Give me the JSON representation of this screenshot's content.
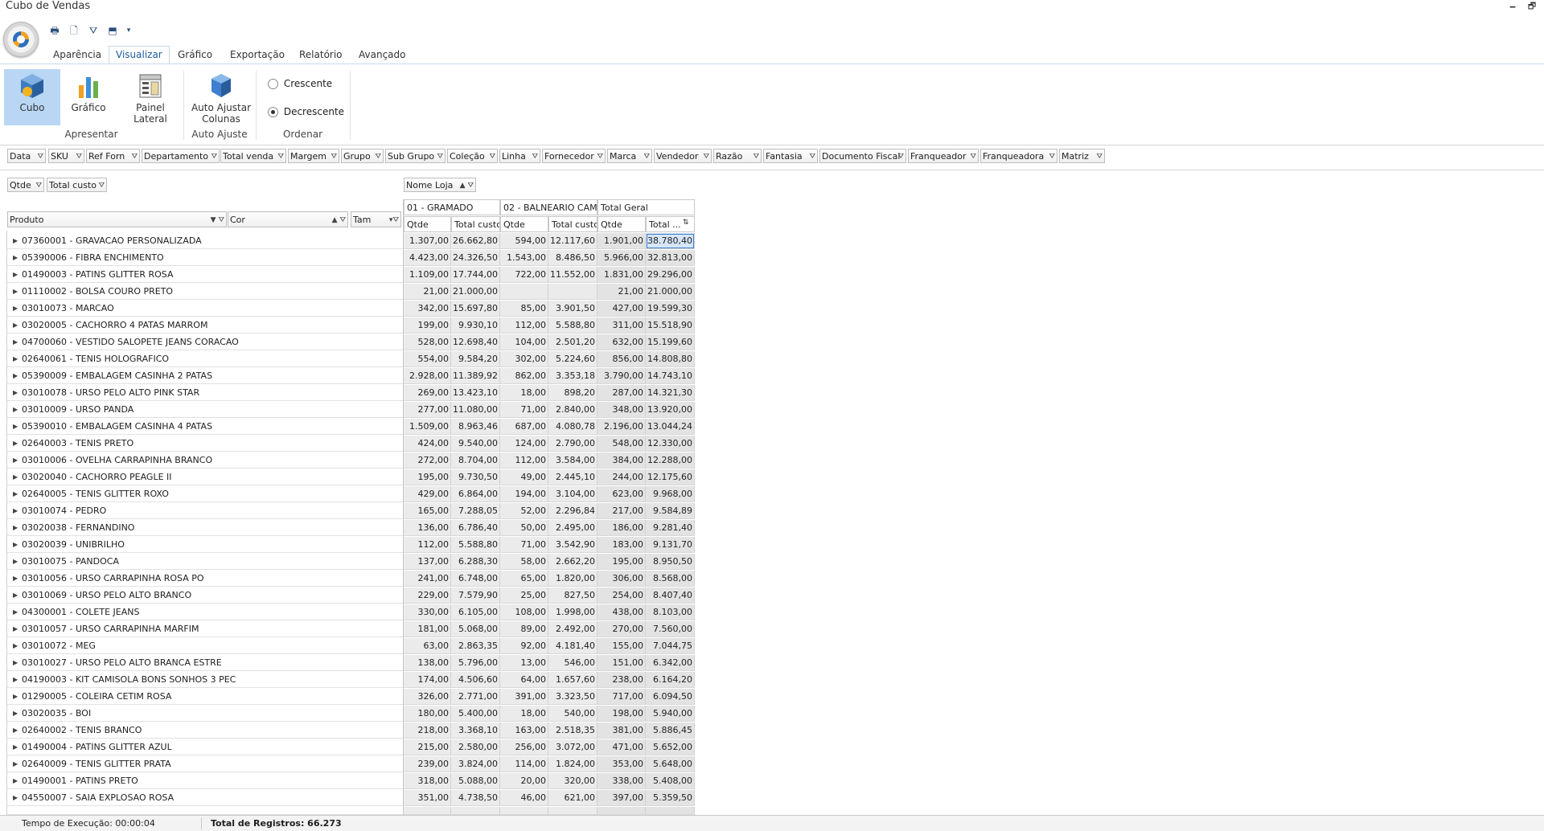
{
  "window": {
    "title": "Cubo de Vendas",
    "minimize": "🗕",
    "restore": "🗗"
  },
  "quick_access": [
    {
      "name": "print-icon",
      "glyph": "🖶"
    },
    {
      "name": "print-preview-icon",
      "glyph": "🗋"
    },
    {
      "name": "filter-icon",
      "glyph": "⛛"
    },
    {
      "name": "export-icon",
      "glyph": "⬒"
    },
    {
      "name": "customize-dropdown-icon",
      "glyph": "▾"
    }
  ],
  "tabs": [
    "Aparência",
    "Visualizar",
    "Gráfico",
    "Exportação",
    "Relatório",
    "Avançado"
  ],
  "active_tab": "Visualizar",
  "ribbon": {
    "cubo": "Cubo",
    "grafico": "Gráfico",
    "painel_1": "Painel",
    "painel_2": "Lateral",
    "auto_1": "Auto Ajustar",
    "auto_2": "Colunas",
    "group_apresentar": "Apresentar",
    "group_auto_ajuste": "Auto Ajuste",
    "group_ordenar": "Ordenar",
    "crescente": "Crescente",
    "decrescente": "Decrescente",
    "selected_order": "Decrescente"
  },
  "filter_fields": [
    "Data",
    "SKU",
    "Ref Forn",
    "Departamento",
    "Total venda",
    "Margem",
    "Grupo",
    "Sub Grupo",
    "Coleção",
    "Linha",
    "Fornecedor",
    "Marca",
    "Vendedor",
    "Razão",
    "Fantasia",
    "Documento Fiscal",
    "Franqueador",
    "Franqueadora",
    "Matriz"
  ],
  "data_fields": [
    "Qtde",
    "Total custo"
  ],
  "column_field": "Nome Loja",
  "row_fields": [
    "Produto",
    "Cor",
    "Tam"
  ],
  "column_groups": [
    "01 - GRAMADO",
    "02 - BALNEARIO CAM...",
    "Total Geral"
  ],
  "column_headers": [
    "Qtde",
    "Total custo",
    "Qtde",
    "Total custo",
    "Qtde",
    "Total ..."
  ],
  "rows": [
    {
      "label": "07360001 - GRAVACAO PERSONALIZADA",
      "v": [
        "1.307,00",
        "26.662,80",
        "594,00",
        "12.117,60",
        "1.901,00",
        "38.780,40"
      ]
    },
    {
      "label": "05390006 - FIBRA ENCHIMENTO",
      "v": [
        "4.423,00",
        "24.326,50",
        "1.543,00",
        "8.486,50",
        "5.966,00",
        "32.813,00"
      ]
    },
    {
      "label": "01490003 - PATINS GLITTER ROSA",
      "v": [
        "1.109,00",
        "17.744,00",
        "722,00",
        "11.552,00",
        "1.831,00",
        "29.296,00"
      ]
    },
    {
      "label": "01110002 - BOLSA COURO PRETO",
      "v": [
        "21,00",
        "21.000,00",
        "",
        "",
        "21,00",
        "21.000,00"
      ]
    },
    {
      "label": "03010073 - MARCAO",
      "v": [
        "342,00",
        "15.697,80",
        "85,00",
        "3.901,50",
        "427,00",
        "19.599,30"
      ]
    },
    {
      "label": "03020005 - CACHORRO 4 PATAS MARROM",
      "v": [
        "199,00",
        "9.930,10",
        "112,00",
        "5.588,80",
        "311,00",
        "15.518,90"
      ]
    },
    {
      "label": "04700060 - VESTIDO SALOPETE JEANS CORACAO",
      "v": [
        "528,00",
        "12.698,40",
        "104,00",
        "2.501,20",
        "632,00",
        "15.199,60"
      ]
    },
    {
      "label": "02640061 - TENIS HOLOGRAFICO",
      "v": [
        "554,00",
        "9.584,20",
        "302,00",
        "5.224,60",
        "856,00",
        "14.808,80"
      ]
    },
    {
      "label": "05390009 - EMBALAGEM CASINHA 2 PATAS",
      "v": [
        "2.928,00",
        "11.389,92",
        "862,00",
        "3.353,18",
        "3.790,00",
        "14.743,10"
      ]
    },
    {
      "label": "03010078 - URSO PELO ALTO PINK STAR",
      "v": [
        "269,00",
        "13.423,10",
        "18,00",
        "898,20",
        "287,00",
        "14.321,30"
      ]
    },
    {
      "label": "03010009 - URSO PANDA",
      "v": [
        "277,00",
        "11.080,00",
        "71,00",
        "2.840,00",
        "348,00",
        "13.920,00"
      ]
    },
    {
      "label": "05390010 - EMBALAGEM CASINHA 4 PATAS",
      "v": [
        "1.509,00",
        "8.963,46",
        "687,00",
        "4.080,78",
        "2.196,00",
        "13.044,24"
      ]
    },
    {
      "label": "02640003 - TENIS PRETO",
      "v": [
        "424,00",
        "9.540,00",
        "124,00",
        "2.790,00",
        "548,00",
        "12.330,00"
      ]
    },
    {
      "label": "03010006 - OVELHA CARRAPINHA BRANCO",
      "v": [
        "272,00",
        "8.704,00",
        "112,00",
        "3.584,00",
        "384,00",
        "12.288,00"
      ]
    },
    {
      "label": "03020040 - CACHORRO PEAGLE II",
      "v": [
        "195,00",
        "9.730,50",
        "49,00",
        "2.445,10",
        "244,00",
        "12.175,60"
      ]
    },
    {
      "label": "02640005 - TENIS GLITTER ROXO",
      "v": [
        "429,00",
        "6.864,00",
        "194,00",
        "3.104,00",
        "623,00",
        "9.968,00"
      ]
    },
    {
      "label": "03010074 - PEDRO",
      "v": [
        "165,00",
        "7.288,05",
        "52,00",
        "2.296,84",
        "217,00",
        "9.584,89"
      ]
    },
    {
      "label": "03020038 - FERNANDINO",
      "v": [
        "136,00",
        "6.786,40",
        "50,00",
        "2.495,00",
        "186,00",
        "9.281,40"
      ]
    },
    {
      "label": "03020039 - UNIBRILHO",
      "v": [
        "112,00",
        "5.588,80",
        "71,00",
        "3.542,90",
        "183,00",
        "9.131,70"
      ]
    },
    {
      "label": "03010075 - PANDOCA",
      "v": [
        "137,00",
        "6.288,30",
        "58,00",
        "2.662,20",
        "195,00",
        "8.950,50"
      ]
    },
    {
      "label": "03010056 - URSO CARRAPINHA ROSA PO",
      "v": [
        "241,00",
        "6.748,00",
        "65,00",
        "1.820,00",
        "306,00",
        "8.568,00"
      ]
    },
    {
      "label": "03010069 - URSO PELO ALTO BRANCO",
      "v": [
        "229,00",
        "7.579,90",
        "25,00",
        "827,50",
        "254,00",
        "8.407,40"
      ]
    },
    {
      "label": "04300001 - COLETE JEANS",
      "v": [
        "330,00",
        "6.105,00",
        "108,00",
        "1.998,00",
        "438,00",
        "8.103,00"
      ]
    },
    {
      "label": "03010057 - URSO CARRAPINHA MARFIM",
      "v": [
        "181,00",
        "5.068,00",
        "89,00",
        "2.492,00",
        "270,00",
        "7.560,00"
      ]
    },
    {
      "label": "03010072 - MEG",
      "v": [
        "63,00",
        "2.863,35",
        "92,00",
        "4.181,40",
        "155,00",
        "7.044,75"
      ]
    },
    {
      "label": "03010027 - URSO PELO ALTO BRANCA ESTRE",
      "v": [
        "138,00",
        "5.796,00",
        "13,00",
        "546,00",
        "151,00",
        "6.342,00"
      ]
    },
    {
      "label": "04190003 - KIT CAMISOLA BONS SONHOS 3 PEC",
      "v": [
        "174,00",
        "4.506,60",
        "64,00",
        "1.657,60",
        "238,00",
        "6.164,20"
      ]
    },
    {
      "label": "01290005 - COLEIRA CETIM ROSA",
      "v": [
        "326,00",
        "2.771,00",
        "391,00",
        "3.323,50",
        "717,00",
        "6.094,50"
      ]
    },
    {
      "label": "03020035 - BOI",
      "v": [
        "180,00",
        "5.400,00",
        "18,00",
        "540,00",
        "198,00",
        "5.940,00"
      ]
    },
    {
      "label": "02640002 - TENIS BRANCO",
      "v": [
        "218,00",
        "3.368,10",
        "163,00",
        "2.518,35",
        "381,00",
        "5.886,45"
      ]
    },
    {
      "label": "01490004 - PATINS GLITTER AZUL",
      "v": [
        "215,00",
        "2.580,00",
        "256,00",
        "3.072,00",
        "471,00",
        "5.652,00"
      ]
    },
    {
      "label": "02640009 - TENIS GLITTER PRATA",
      "v": [
        "239,00",
        "3.824,00",
        "114,00",
        "1.824,00",
        "353,00",
        "5.648,00"
      ]
    },
    {
      "label": "01490001 - PATINS PRETO",
      "v": [
        "318,00",
        "5.088,00",
        "20,00",
        "320,00",
        "338,00",
        "5.408,00"
      ]
    },
    {
      "label": "04550007 - SAIA EXPLOSAO ROSA",
      "v": [
        "351,00",
        "4.738,50",
        "46,00",
        "621,00",
        "397,00",
        "5.359,50"
      ]
    }
  ],
  "status": {
    "exec_time": "Tempo de Execução: 00:00:04",
    "records": "Total de Registros: 66.273"
  }
}
